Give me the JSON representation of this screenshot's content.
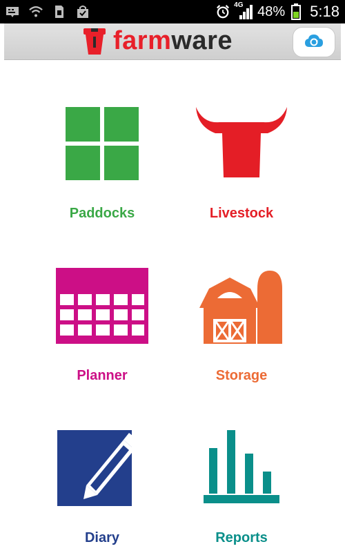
{
  "status_bar": {
    "network_label": "4G",
    "battery": "48%",
    "time": "5:18",
    "icons": [
      "keyboard-icon",
      "wifi-question-icon",
      "sim-icon",
      "shopping-bag-icon",
      "alarm-icon",
      "signal-icon",
      "battery-icon"
    ]
  },
  "app_bar": {
    "brand_farm": "farm",
    "brand_ware": "ware",
    "sync_icon": "cloud-sync-icon"
  },
  "colors": {
    "paddocks": "#3aa846",
    "livestock": "#e41e26",
    "planner": "#cc0f86",
    "storage": "#ec6b35",
    "diary": "#233f8c",
    "reports": "#0a8f8a"
  },
  "menu": [
    {
      "label": "Paddocks",
      "icon": "paddock-grid-icon"
    },
    {
      "label": "Livestock",
      "icon": "bull-head-icon"
    },
    {
      "label": "Planner",
      "icon": "calendar-icon"
    },
    {
      "label": "Storage",
      "icon": "barn-icon"
    },
    {
      "label": "Diary",
      "icon": "diary-pencil-icon"
    },
    {
      "label": "Reports",
      "icon": "bar-chart-icon"
    }
  ]
}
